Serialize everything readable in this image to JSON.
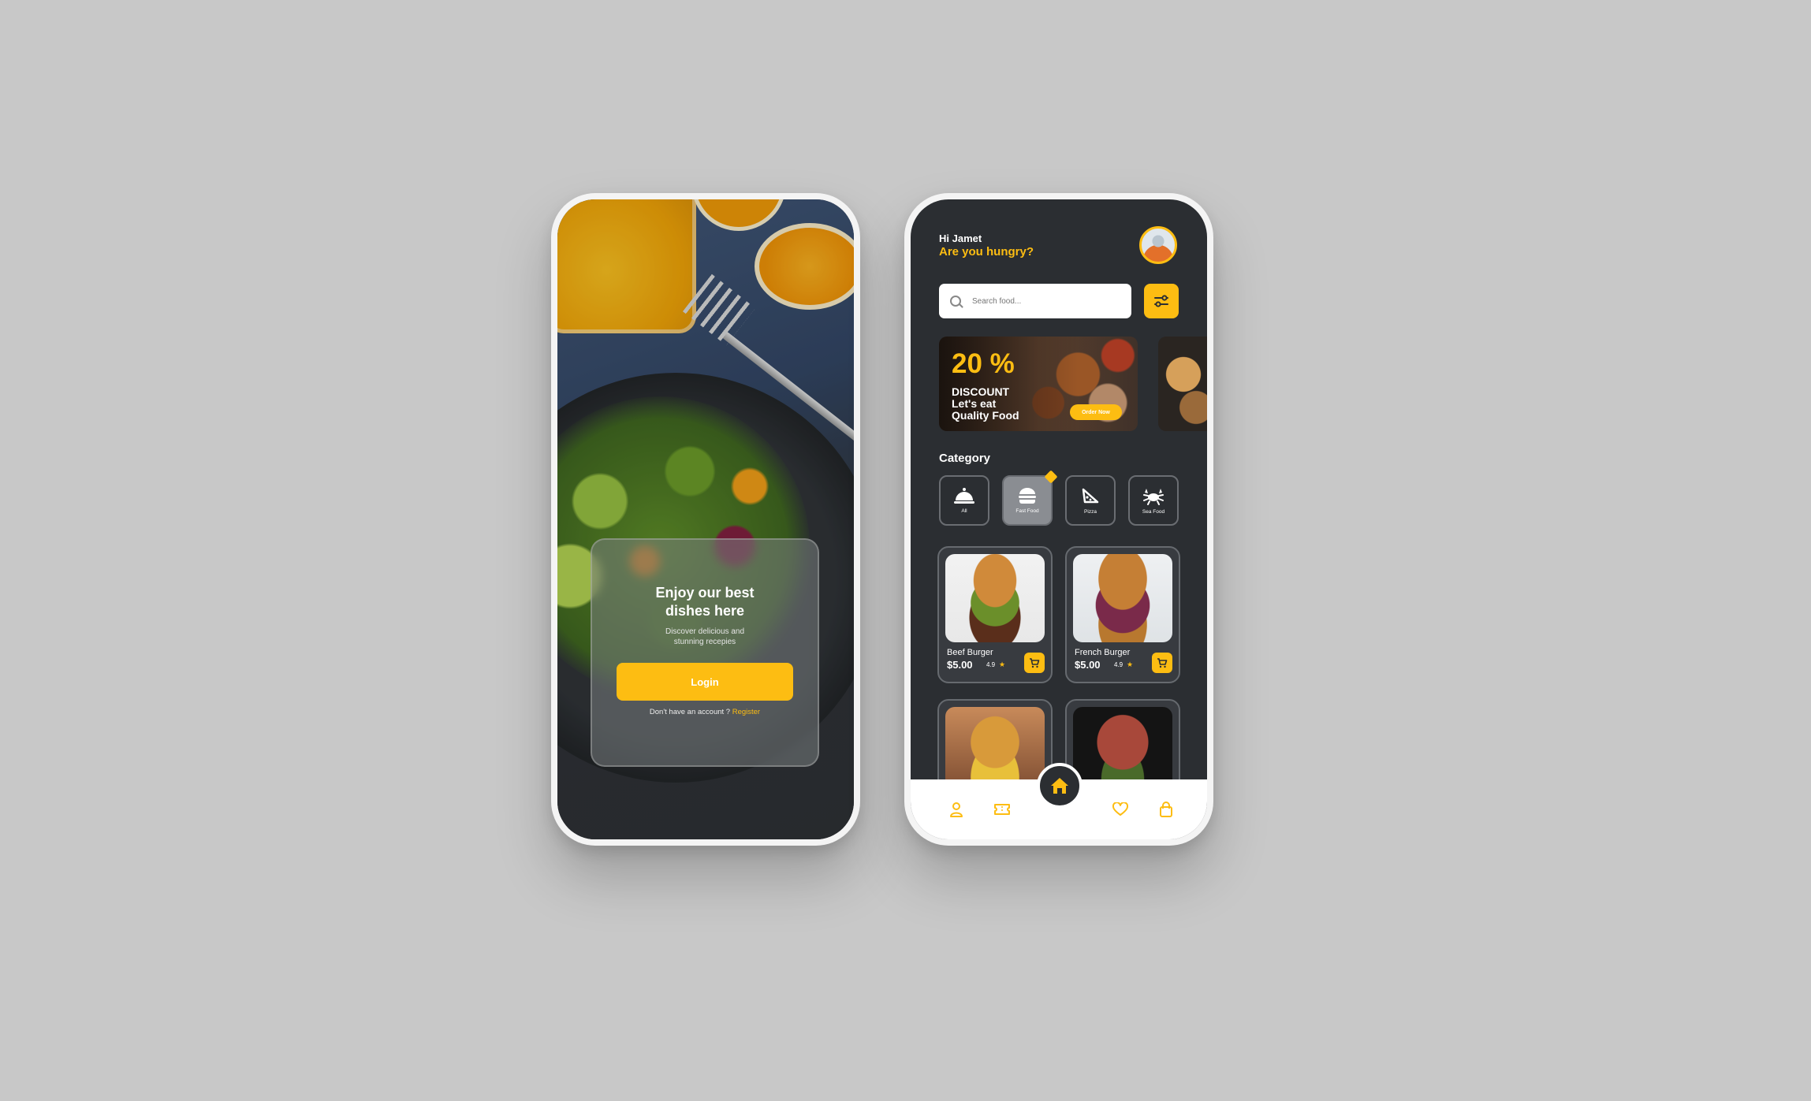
{
  "login_screen": {
    "title": "Enjoy our best dishes here",
    "subtitle": "Discover delicious and stunning recepies",
    "login_button": "Login",
    "register_prompt": "Don't have an account ?",
    "register_link": "Register"
  },
  "home_screen": {
    "greeting": "Hi Jamet",
    "question": "Are you hungry?",
    "search": {
      "placeholder": "Search food..."
    },
    "banner": {
      "percent": "20 %",
      "discount": "DISCOUNT",
      "line1": "Let's eat",
      "line2": "Quality Food",
      "button": "Order Now"
    },
    "category_title": "Category",
    "categories": [
      {
        "label": "All",
        "icon": "cloche-icon",
        "active": false
      },
      {
        "label": "Fast Food",
        "icon": "burger-icon",
        "active": true
      },
      {
        "label": "Pizza",
        "icon": "pizza-icon",
        "active": false
      },
      {
        "label": "Sea Food",
        "icon": "crab-icon",
        "active": false
      }
    ],
    "products": [
      {
        "name": "Beef Burger",
        "price": "$5.00",
        "rating": "4.9"
      },
      {
        "name": "French Burger",
        "price": "$5.00",
        "rating": "4.9"
      }
    ],
    "nav": [
      "profile-icon",
      "ticket-icon",
      "home-icon",
      "heart-icon",
      "bag-icon"
    ]
  },
  "colors": {
    "accent": "#fdbd12",
    "dark": "#2b2e32",
    "background": "#c8c8c8"
  }
}
